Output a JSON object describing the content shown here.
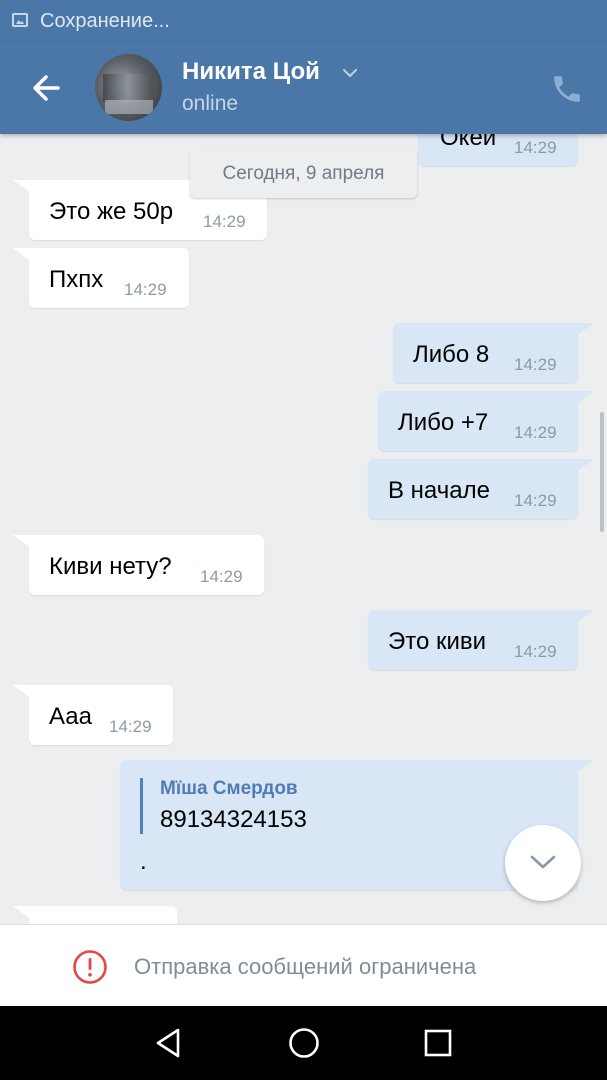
{
  "status_bar": {
    "text": "Сохранение...",
    "icon": "image-icon"
  },
  "header": {
    "back_icon": "arrow-left-icon",
    "contact_name": "Никита Цой",
    "contact_status": "online",
    "call_icon": "phone-icon",
    "colors": {
      "bar": "#4a76a8",
      "accent": "#5181b8"
    }
  },
  "chat": {
    "date_separator": "Сегодня, 9 апреля",
    "messages": [
      {
        "dir": "out",
        "text": "Окей",
        "time": "14:29"
      },
      {
        "dir": "in",
        "text": "Это же 50р",
        "time": "14:29"
      },
      {
        "dir": "in",
        "text": "Пхпх",
        "time": "14:29"
      },
      {
        "dir": "out",
        "text": "Либо 8",
        "time": "14:29"
      },
      {
        "dir": "out",
        "text": "Либо +7",
        "time": "14:29"
      },
      {
        "dir": "out",
        "text": "В начале",
        "time": "14:29"
      },
      {
        "dir": "in",
        "text": "Киви нету?",
        "time": "14:29"
      },
      {
        "dir": "out",
        "text": "Это киви",
        "time": "14:29"
      },
      {
        "dir": "in",
        "text": "Ааа",
        "time": "14:29"
      }
    ],
    "forwarded": {
      "author": "Mïша Смердов",
      "text": "89134324153",
      "body": "."
    }
  },
  "restriction": {
    "text": "Отправка сообщений ограничена",
    "icon": "exclamation-circle-icon",
    "color": "#e64646"
  },
  "nav": {
    "back_icon": "triangle-back-icon",
    "home_icon": "circle-home-icon",
    "recents_icon": "square-recents-icon"
  }
}
